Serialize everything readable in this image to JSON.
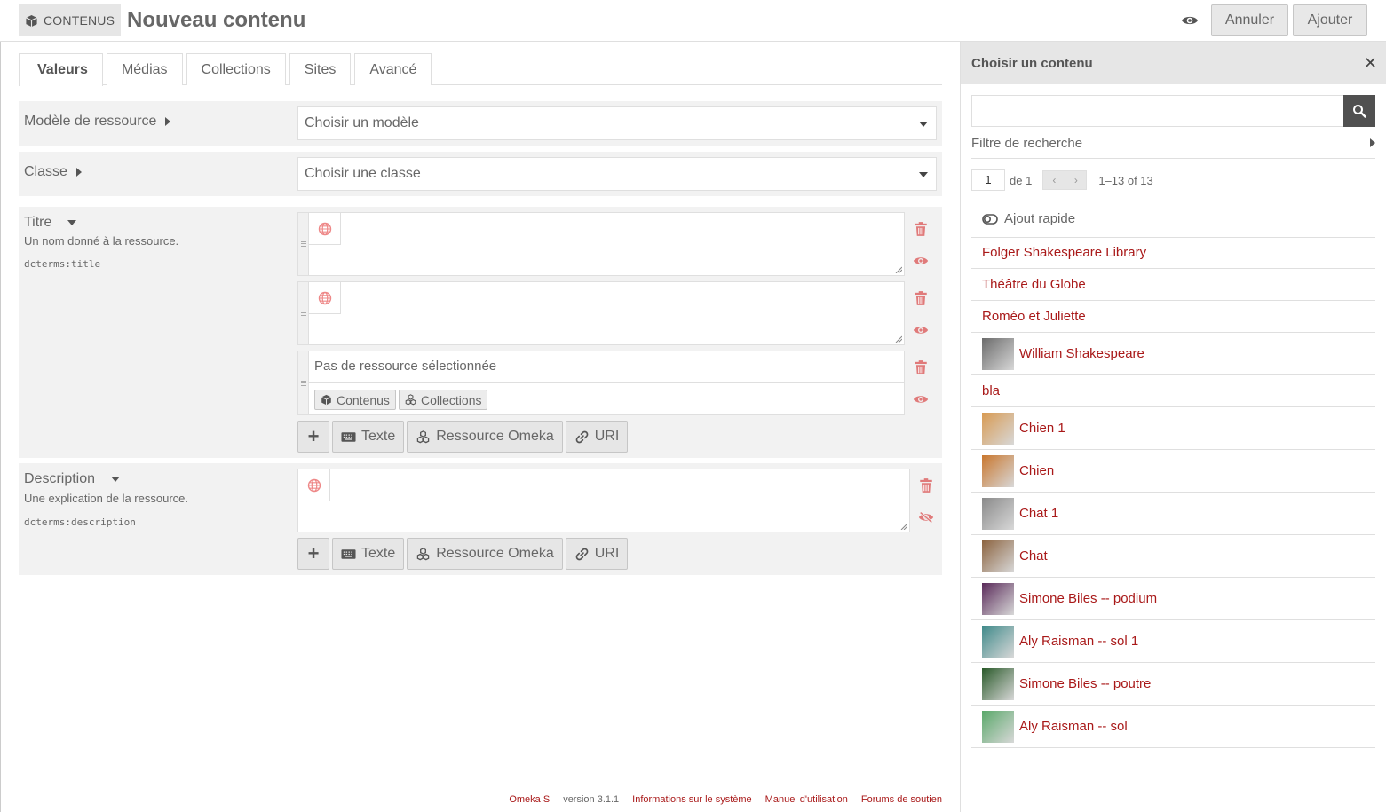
{
  "header": {
    "section_label": "CONTENUS",
    "title": "Nouveau contenu",
    "cancel_label": "Annuler",
    "add_label": "Ajouter"
  },
  "tabs": [
    {
      "label": "Valeurs",
      "active": true
    },
    {
      "label": "Médias"
    },
    {
      "label": "Collections"
    },
    {
      "label": "Sites"
    },
    {
      "label": "Avancé"
    }
  ],
  "fields": {
    "template": {
      "label": "Modèle de ressource",
      "value": "Choisir un modèle"
    },
    "class": {
      "label": "Classe",
      "value": "Choisir une classe"
    },
    "title": {
      "label": "Titre",
      "description": "Un nom donné à la ressource.",
      "term": "dcterms:title",
      "no_resource": "Pas de ressource sélectionnée",
      "res_buttons": [
        "Contenus",
        "Collections"
      ]
    },
    "description": {
      "label": "Description",
      "description": "Une explication de la ressource.",
      "term": "dcterms:description"
    }
  },
  "add_buttons": {
    "text": "Texte",
    "resource": "Ressource Omeka",
    "uri": "URI"
  },
  "footer": {
    "brand": "Omeka S",
    "version": "version 3.1.1",
    "links": [
      "Informations sur le système",
      "Manuel d'utilisation",
      "Forums de soutien"
    ]
  },
  "sidebar": {
    "title": "Choisir un contenu",
    "search_placeholder": "",
    "filter_label": "Filtre de recherche",
    "page": "1",
    "page_of": "de 1",
    "count": "1–13 of 13",
    "quick_add": "Ajout rapide",
    "items": [
      {
        "label": "Folger Shakespeare Library",
        "thumb": null
      },
      {
        "label": "Théâtre du Globe",
        "thumb": null
      },
      {
        "label": "Roméo et Juliette",
        "thumb": null
      },
      {
        "label": "William Shakespeare",
        "thumb": "#6b6b6b"
      },
      {
        "label": "bla",
        "thumb": null
      },
      {
        "label": "Chien 1",
        "thumb": "#d89a52"
      },
      {
        "label": "Chien",
        "thumb": "#c9772e"
      },
      {
        "label": "Chat 1",
        "thumb": "#8a8a8a"
      },
      {
        "label": "Chat",
        "thumb": "#8c6440"
      },
      {
        "label": "Simone Biles -- podium",
        "thumb": "#5a2a5a"
      },
      {
        "label": "Aly Raisman -- sol 1",
        "thumb": "#3f8a8a"
      },
      {
        "label": "Simone Biles -- poutre",
        "thumb": "#2a5a2a"
      },
      {
        "label": "Aly Raisman -- sol",
        "thumb": "#5aa86a"
      }
    ]
  },
  "colors": {
    "accent": "#a91919",
    "button_bg": "#e6e6e6",
    "panel_bg": "#f2f2f2"
  }
}
